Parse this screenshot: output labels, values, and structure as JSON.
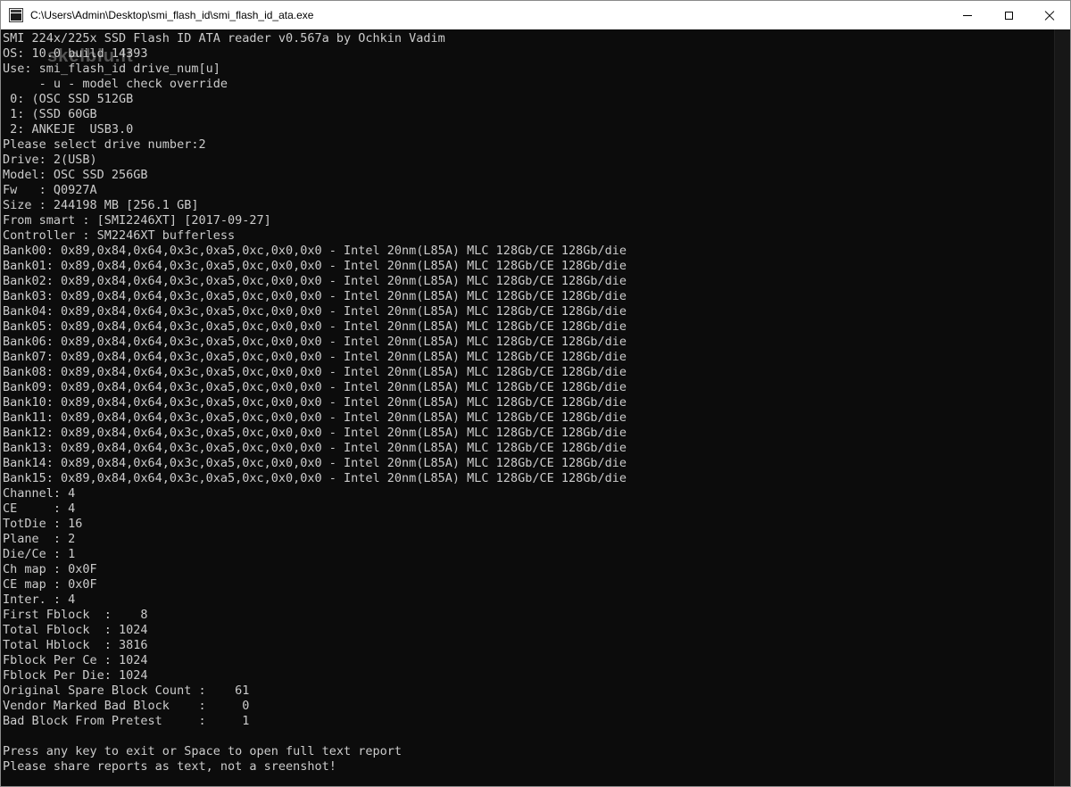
{
  "window": {
    "title": "C:\\Users\\Admin\\Desktop\\smi_flash_id\\smi_flash_id_ata.exe"
  },
  "watermark": "skelbiu.lt",
  "console": {
    "lines": [
      "SMI 224x/225x SSD Flash ID ATA reader v0.567a by Ochkin Vadim",
      "OS: 10.0 build 14393",
      "Use: smi_flash_id drive_num[u]",
      "     - u - model check override",
      " 0: (OSC SSD 512GB",
      " 1: (SSD 60GB",
      " 2: ANKEJE  USB3.0",
      "Please select drive number:2",
      "Drive: 2(USB)",
      "Model: OSC SSD 256GB",
      "Fw   : Q0927A",
      "Size : 244198 MB [256.1 GB]",
      "From smart : [SMI2246XT] [2017-09-27]",
      "Controller : SM2246XT bufferless",
      "Bank00: 0x89,0x84,0x64,0x3c,0xa5,0xc,0x0,0x0 - Intel 20nm(L85A) MLC 128Gb/CE 128Gb/die",
      "Bank01: 0x89,0x84,0x64,0x3c,0xa5,0xc,0x0,0x0 - Intel 20nm(L85A) MLC 128Gb/CE 128Gb/die",
      "Bank02: 0x89,0x84,0x64,0x3c,0xa5,0xc,0x0,0x0 - Intel 20nm(L85A) MLC 128Gb/CE 128Gb/die",
      "Bank03: 0x89,0x84,0x64,0x3c,0xa5,0xc,0x0,0x0 - Intel 20nm(L85A) MLC 128Gb/CE 128Gb/die",
      "Bank04: 0x89,0x84,0x64,0x3c,0xa5,0xc,0x0,0x0 - Intel 20nm(L85A) MLC 128Gb/CE 128Gb/die",
      "Bank05: 0x89,0x84,0x64,0x3c,0xa5,0xc,0x0,0x0 - Intel 20nm(L85A) MLC 128Gb/CE 128Gb/die",
      "Bank06: 0x89,0x84,0x64,0x3c,0xa5,0xc,0x0,0x0 - Intel 20nm(L85A) MLC 128Gb/CE 128Gb/die",
      "Bank07: 0x89,0x84,0x64,0x3c,0xa5,0xc,0x0,0x0 - Intel 20nm(L85A) MLC 128Gb/CE 128Gb/die",
      "Bank08: 0x89,0x84,0x64,0x3c,0xa5,0xc,0x0,0x0 - Intel 20nm(L85A) MLC 128Gb/CE 128Gb/die",
      "Bank09: 0x89,0x84,0x64,0x3c,0xa5,0xc,0x0,0x0 - Intel 20nm(L85A) MLC 128Gb/CE 128Gb/die",
      "Bank10: 0x89,0x84,0x64,0x3c,0xa5,0xc,0x0,0x0 - Intel 20nm(L85A) MLC 128Gb/CE 128Gb/die",
      "Bank11: 0x89,0x84,0x64,0x3c,0xa5,0xc,0x0,0x0 - Intel 20nm(L85A) MLC 128Gb/CE 128Gb/die",
      "Bank12: 0x89,0x84,0x64,0x3c,0xa5,0xc,0x0,0x0 - Intel 20nm(L85A) MLC 128Gb/CE 128Gb/die",
      "Bank13: 0x89,0x84,0x64,0x3c,0xa5,0xc,0x0,0x0 - Intel 20nm(L85A) MLC 128Gb/CE 128Gb/die",
      "Bank14: 0x89,0x84,0x64,0x3c,0xa5,0xc,0x0,0x0 - Intel 20nm(L85A) MLC 128Gb/CE 128Gb/die",
      "Bank15: 0x89,0x84,0x64,0x3c,0xa5,0xc,0x0,0x0 - Intel 20nm(L85A) MLC 128Gb/CE 128Gb/die",
      "Channel: 4",
      "CE     : 4",
      "TotDie : 16",
      "Plane  : 2",
      "Die/Ce : 1",
      "Ch map : 0x0F",
      "CE map : 0x0F",
      "Inter. : 4",
      "First Fblock  :    8",
      "Total Fblock  : 1024",
      "Total Hblock  : 3816",
      "Fblock Per Ce : 1024",
      "Fblock Per Die: 1024",
      "Original Spare Block Count :    61",
      "Vendor Marked Bad Block    :     0",
      "Bad Block From Pretest     :     1",
      "",
      "Press any key to exit or Space to open full text report",
      "Please share reports as text, not a sreenshot!"
    ]
  }
}
